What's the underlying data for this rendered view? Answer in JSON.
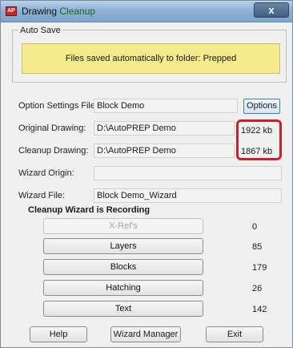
{
  "window": {
    "title_prefix": "Drawing ",
    "title_accent": "Cleanup",
    "close_label": "x",
    "app_icon": "AP"
  },
  "autosave": {
    "group_label": "Auto Save",
    "message": "Files saved automatically to folder: Prepped"
  },
  "fields": {
    "option_settings": {
      "label": "Option Settings File:",
      "value": "Block Demo"
    },
    "original_drawing": {
      "label": "Original Drawing:",
      "value": "D:\\AutoPREP Demo",
      "size": "1922 kb"
    },
    "cleanup_drawing": {
      "label": "Cleanup Drawing:",
      "value": "D:\\AutoPREP Demo",
      "size": "1867 kb"
    },
    "wizard_origin": {
      "label": "Wizard Origin:",
      "value": ""
    },
    "wizard_file": {
      "label": "Wizard File:",
      "value": "Block Demo_Wizard"
    }
  },
  "options_button": "Options",
  "recording_title": "Cleanup Wizard is Recording",
  "wizard_items": [
    {
      "label": "X-Ref's",
      "count": "0",
      "enabled": false
    },
    {
      "label": "Layers",
      "count": "85",
      "enabled": true
    },
    {
      "label": "Blocks",
      "count": "179",
      "enabled": true
    },
    {
      "label": "Hatching",
      "count": "26",
      "enabled": true
    },
    {
      "label": "Text",
      "count": "142",
      "enabled": true
    }
  ],
  "buttons": {
    "help": "Help",
    "wizard_manager": "Wizard Manager",
    "exit": "Exit"
  },
  "colors": {
    "autosave_bg": "#f5ea8c",
    "highlight": "#cf1f2a",
    "title_accent": "#0f6f1a"
  }
}
